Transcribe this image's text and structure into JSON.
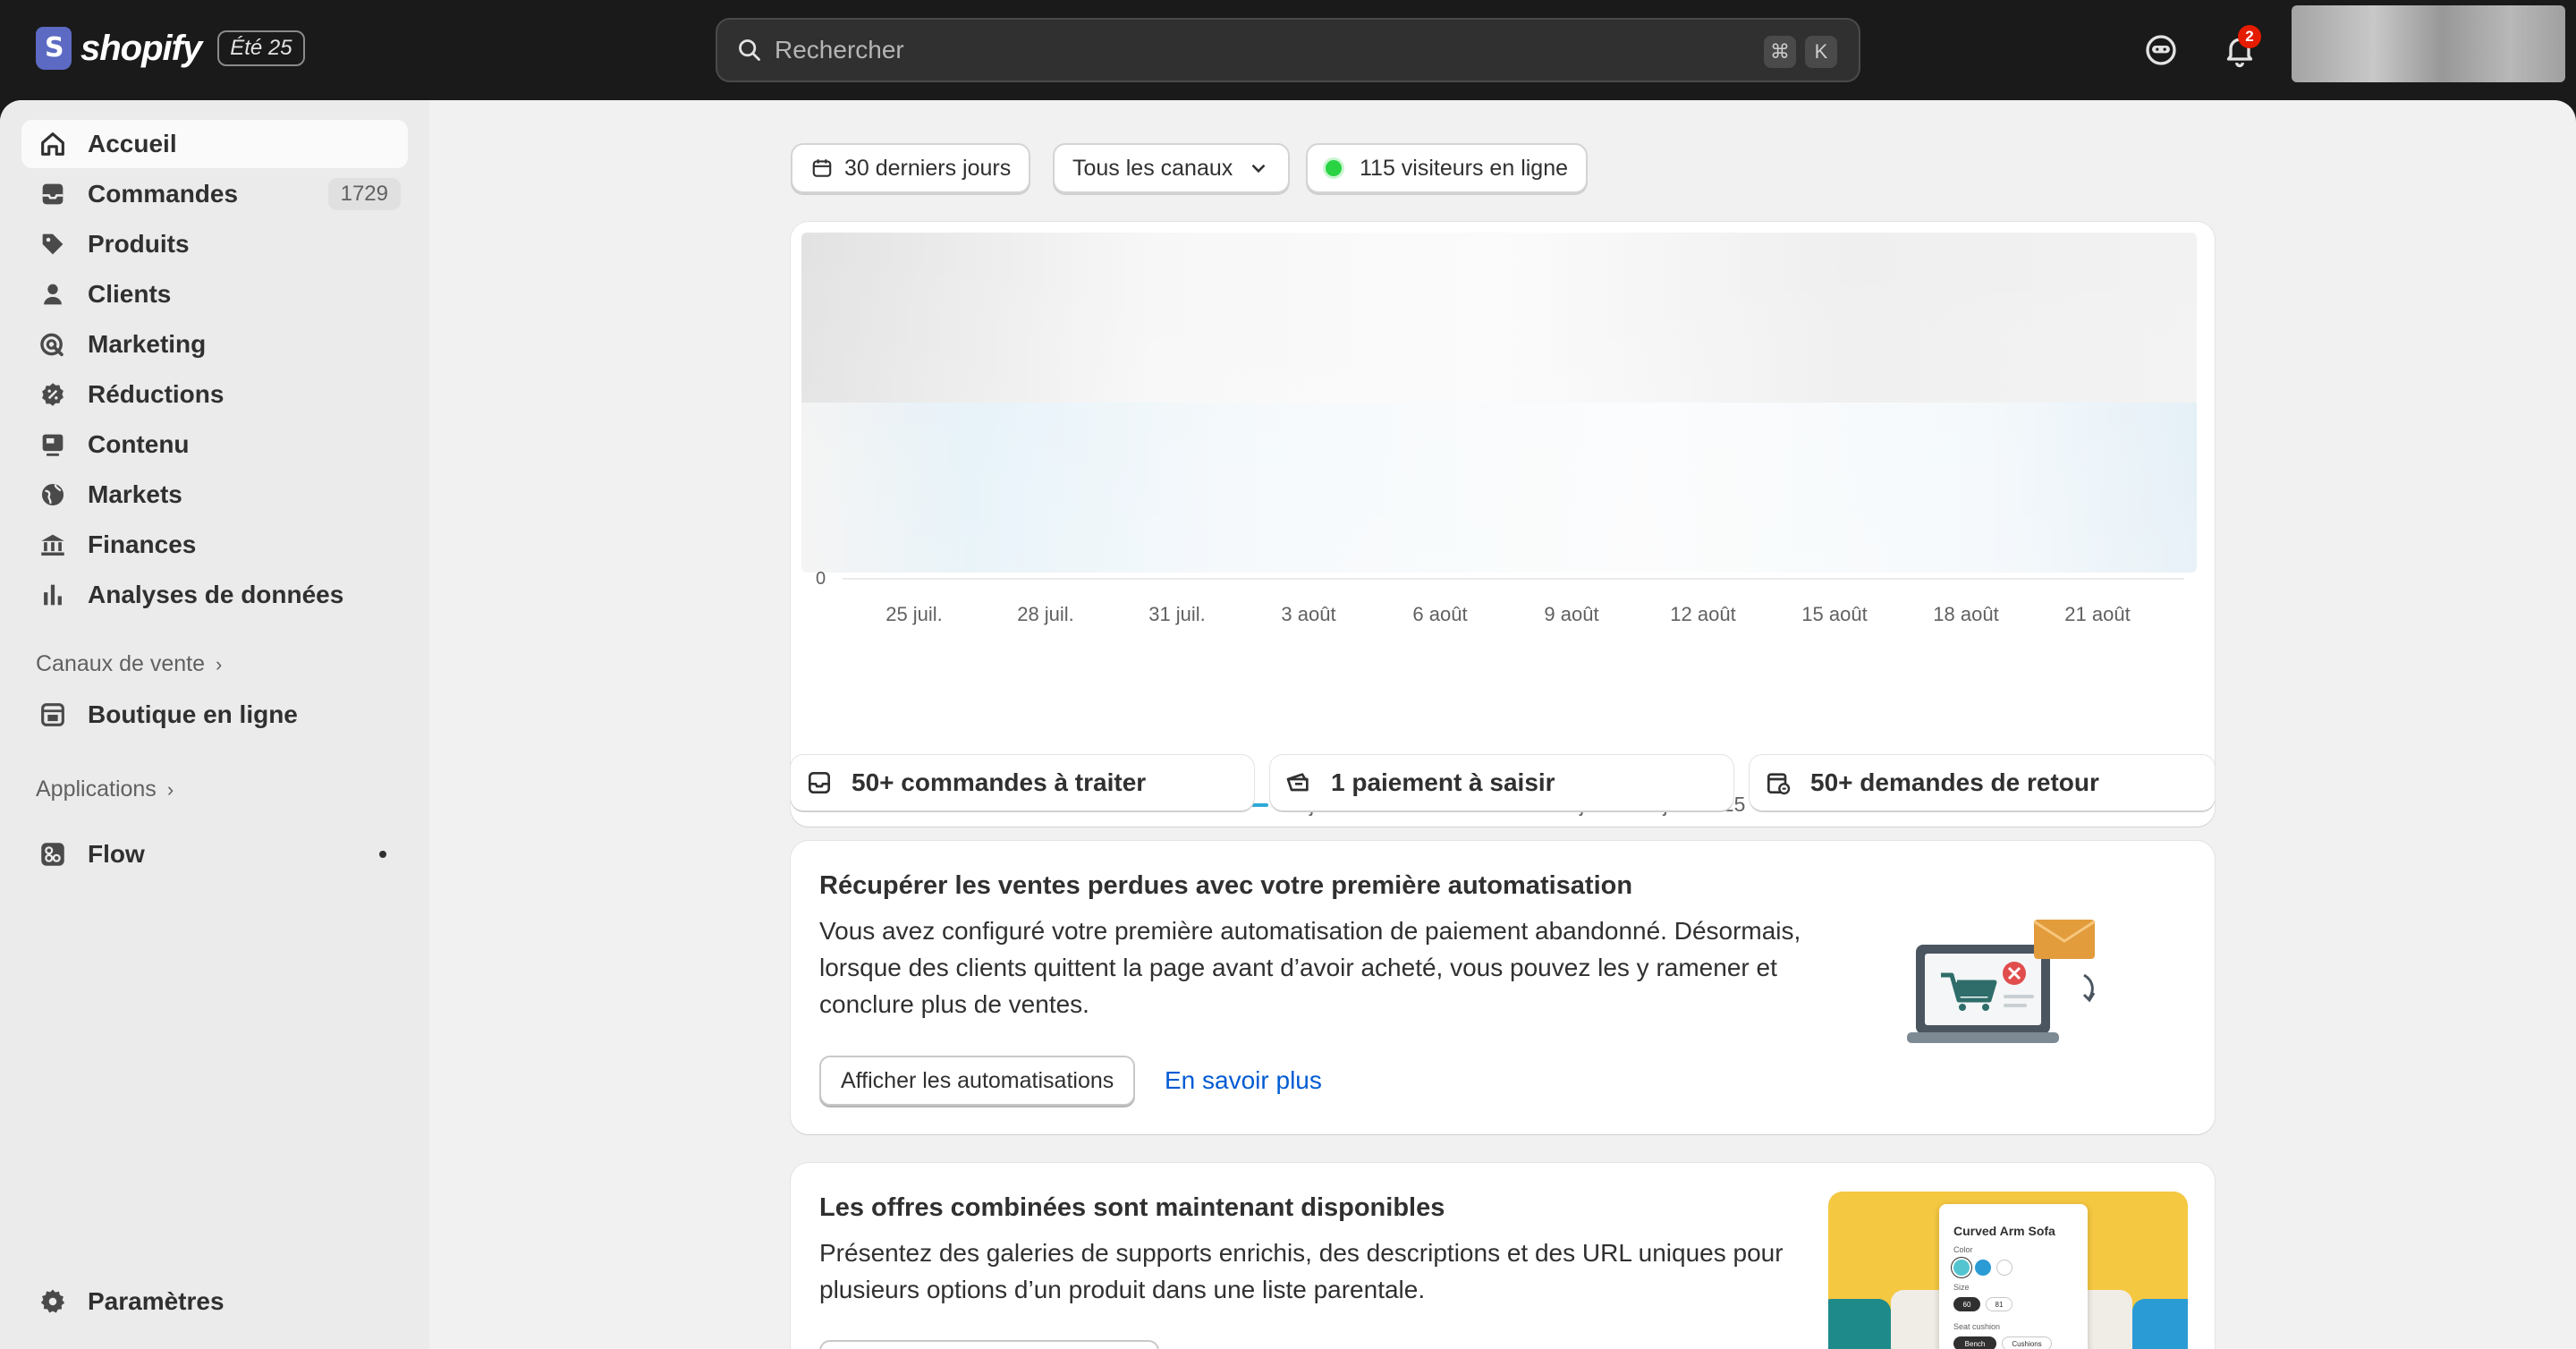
{
  "topbar": {
    "brand": "shopify",
    "edition_badge": "Été 25",
    "search_placeholder": "Rechercher",
    "shortcut_keys": [
      "⌘",
      "K"
    ],
    "notification_count": "2"
  },
  "sidebar": {
    "items": [
      {
        "label": "Accueil",
        "icon": "home-icon",
        "active": true
      },
      {
        "label": "Commandes",
        "icon": "inbox-icon",
        "count": "1729"
      },
      {
        "label": "Produits",
        "icon": "tag-icon"
      },
      {
        "label": "Clients",
        "icon": "person-icon"
      },
      {
        "label": "Marketing",
        "icon": "target-icon"
      },
      {
        "label": "Réductions",
        "icon": "discount-icon"
      },
      {
        "label": "Contenu",
        "icon": "content-icon"
      },
      {
        "label": "Markets",
        "icon": "globe-icon"
      },
      {
        "label": "Finances",
        "icon": "bank-icon"
      },
      {
        "label": "Analyses de données",
        "icon": "bar-chart-icon"
      }
    ],
    "sales_channels_title": "Canaux de vente",
    "online_store": "Boutique en ligne",
    "apps_title": "Applications",
    "flow": "Flow",
    "settings": "Paramètres"
  },
  "filters": {
    "date_range": "30 derniers jours",
    "channels": "Tous les canaux",
    "visitors": "115 visiteurs en ligne"
  },
  "chart_data": {
    "type": "line",
    "x": [
      "25 juil.",
      "28 juil.",
      "31 juil.",
      "3 août",
      "6 août",
      "9 août",
      "12 août",
      "15 août",
      "18 août",
      "21 août"
    ],
    "y_tick": "0",
    "series": [
      {
        "name": "25 juil. – 23 août 2025",
        "color": "#2fa9d8"
      },
      {
        "name": "25 juin – 24 juil. 2025",
        "color": "#b5b5b5"
      }
    ]
  },
  "tasks": {
    "orders": "50+ commandes à traiter",
    "payment": "1 paiement à saisir",
    "returns": "50+ demandes de retour"
  },
  "automation_card": {
    "title": "Récupérer les ventes perdues avec votre première automatisation",
    "body_lines": [
      "Vous avez configuré votre première automatisation de paiement abandonné. Désormais,",
      "lorsque des clients quittent la page avant d’avoir acheté, vous pouvez les y ramener et",
      "conclure plus de ventes."
    ],
    "primary_button": "Afficher les automatisations",
    "link": "En savoir plus"
  },
  "bundles_card": {
    "title": "Les offres combinées sont maintenant disponibles",
    "body_lines": [
      "Présentez des galeries de supports enrichis, des descriptions et des URL uniques pour",
      "plusieurs options d’un produit dans une liste parentale."
    ],
    "product": {
      "title": "Curved Arm Sofa",
      "color_label": "Color",
      "size_label": "Size",
      "sizes": [
        "60",
        "81"
      ],
      "seat_label": "Seat cushion",
      "seat_options": [
        "Bench",
        "Cushions"
      ]
    }
  }
}
